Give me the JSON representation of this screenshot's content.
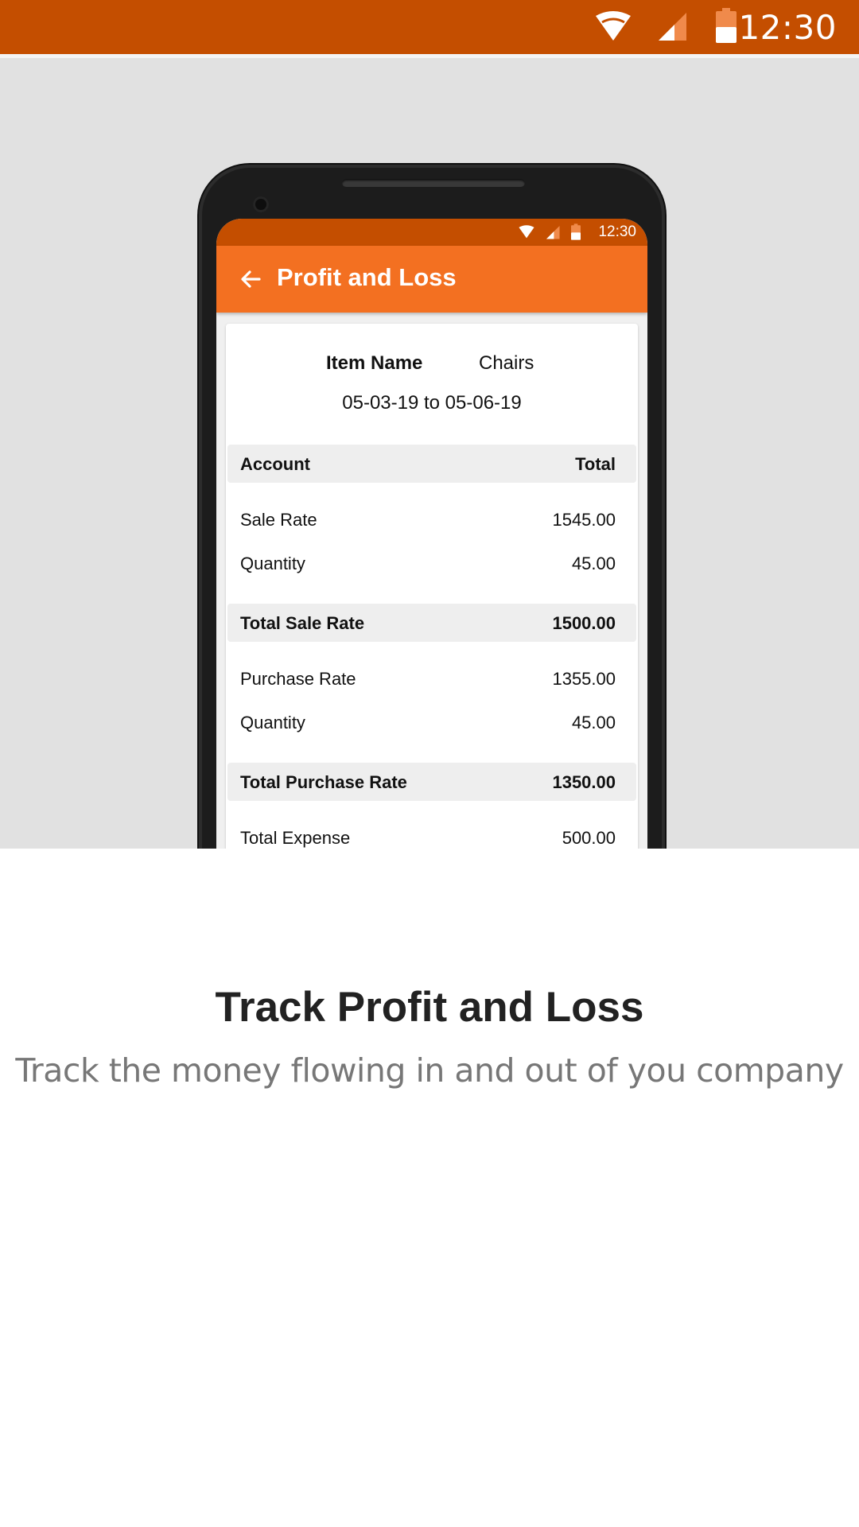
{
  "status_bar": {
    "time": "12:30"
  },
  "phone": {
    "status_time": "12:30",
    "app_bar": {
      "title": "Profit and Loss"
    },
    "item": {
      "label": "Item Name",
      "value": "Chairs"
    },
    "date_range": "05-03-19 to 05-06-19",
    "table": {
      "header": {
        "account": "Account",
        "total": "Total"
      },
      "rows": [
        {
          "label": "Sale Rate",
          "value": "1545.00"
        },
        {
          "label": "Quantity",
          "value": "45.00"
        },
        {
          "label": "Total Sale Rate",
          "value": "1500.00"
        },
        {
          "label": "Purchase Rate",
          "value": "1355.00"
        },
        {
          "label": "Quantity",
          "value": "45.00"
        },
        {
          "label": "Total Purchase Rate",
          "value": "1350.00"
        },
        {
          "label": "Total Expense",
          "value": "500.00"
        }
      ]
    }
  },
  "caption": {
    "title": "Track Profit and Loss",
    "subtitle": "Track the money flowing in and out of you company"
  },
  "colors": {
    "status_bar": "#c44e00",
    "app_bar": "#f37021",
    "hero_background": "#e1e1e1",
    "title_text": "#222222",
    "subtitle_text": "#777777"
  },
  "icons": [
    "wifi-icon",
    "signal-icon",
    "battery-icon",
    "back-arrow-icon"
  ]
}
